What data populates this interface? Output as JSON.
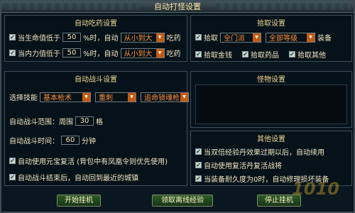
{
  "window": {
    "title": "自动打怪设置"
  },
  "potion": {
    "title": "自动吃药设置",
    "hp": {
      "label_before": "当生命值低于",
      "value": "50",
      "label_after": "%时，自动",
      "select": "从小到大",
      "tail": "吃药"
    },
    "mp": {
      "label_before": "当内力值低于",
      "value": "50",
      "label_after": "%时，自动",
      "select": "从小到大",
      "tail": "吃药"
    }
  },
  "pickup": {
    "title": "拾取设置",
    "pick_label": "拾取",
    "faction_select": "全门派",
    "level_select": "全部等级",
    "equip_label": "装备",
    "money": "拾取金钱",
    "medicine": "拾取药品",
    "other": "拾取其他"
  },
  "combat": {
    "title": "自动战斗设置",
    "skill_label": "选择技能",
    "skills": [
      "基本枪术",
      "重刺",
      "追命锁魂枪"
    ],
    "range_before": "自动战斗范围：周围",
    "range_value": "30",
    "range_after": "格",
    "time_before": "自动战斗时间：",
    "time_value": "60",
    "time_after": "分钟",
    "revive_item": "自动使用元宝复活 (背包中有凤凰令则优先使用)",
    "return_city": "自动战斗结束后，自动回到最近的城镇"
  },
  "monster": {
    "title": "怪物设置"
  },
  "other": {
    "title": "其他设置",
    "exp_pill": "当双倍经验丹效果过期以后，自动续用",
    "revive_pill": "自动使用复活丹复活战将",
    "repair": "当装备耐久度为0时，自动修理损坏装备"
  },
  "buttons": {
    "start": "开始挂机",
    "offline_exp": "领取离线经验",
    "stop": "停止挂机"
  },
  "watermark": "1010"
}
